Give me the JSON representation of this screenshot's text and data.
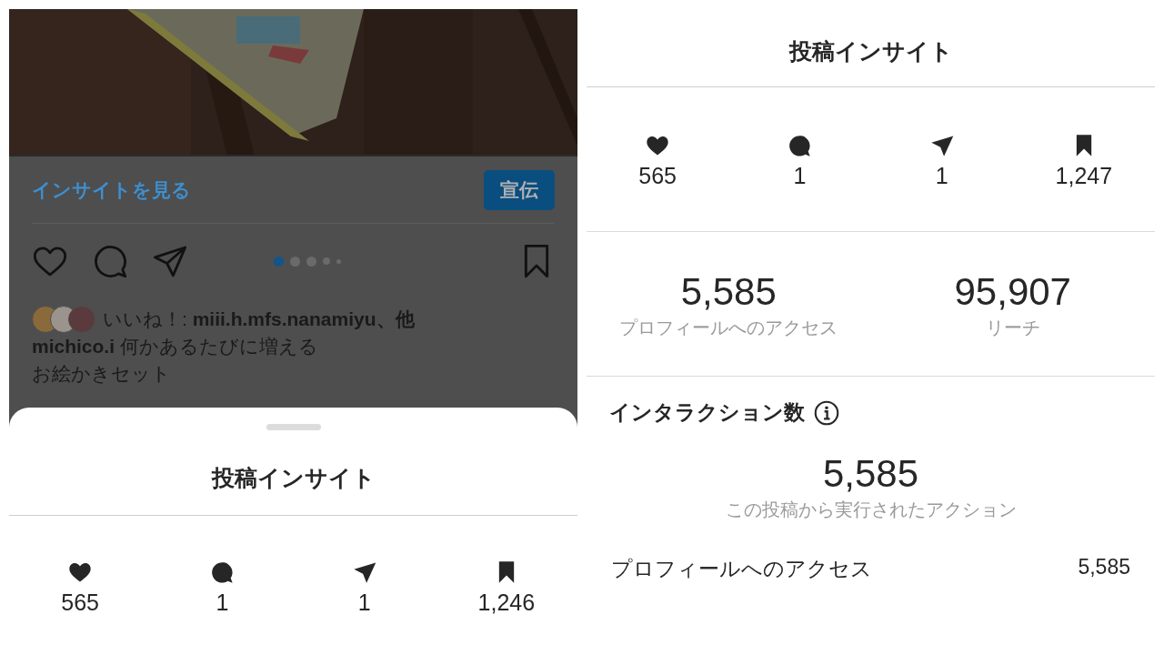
{
  "left_screen": {
    "post": {
      "insights_link": "インサイトを見る",
      "promote_button": "宣伝",
      "carousel_dots": [
        {
          "selected": true
        },
        {
          "selected": false
        },
        {
          "selected": false
        },
        {
          "selected": false
        },
        {
          "selected": false
        }
      ],
      "likes": "いいね！: **miii.h.mfs.nanamiyu、他**",
      "caption": "**michico.i** 何かあるたびに増える",
      "caption_line2": "お絵かきセット"
    },
    "sheet": {
      "title": "投稿インサイト",
      "stats": [
        {
          "kind": "like",
          "value": "565"
        },
        {
          "kind": "comment",
          "value": "1"
        },
        {
          "kind": "share",
          "value": "1"
        },
        {
          "kind": "save",
          "value": "1,246"
        }
      ]
    }
  },
  "right_screen": {
    "title": "投稿インサイト",
    "stats": [
      {
        "kind": "like",
        "value": "565"
      },
      {
        "kind": "comment",
        "value": "1"
      },
      {
        "kind": "share",
        "value": "1"
      },
      {
        "kind": "save",
        "value": "1,247"
      }
    ],
    "summary": [
      {
        "value": "5,585",
        "label": "プロフィールへのアクセス"
      },
      {
        "value": "95,907",
        "label": "リーチ"
      }
    ],
    "interactions": {
      "heading": "インタラクション数",
      "total": "5,585",
      "total_label": "この投稿から実行されたアクション",
      "rows": [
        {
          "label": "プロフィールへのアクセス",
          "value": "5,585"
        }
      ]
    }
  }
}
